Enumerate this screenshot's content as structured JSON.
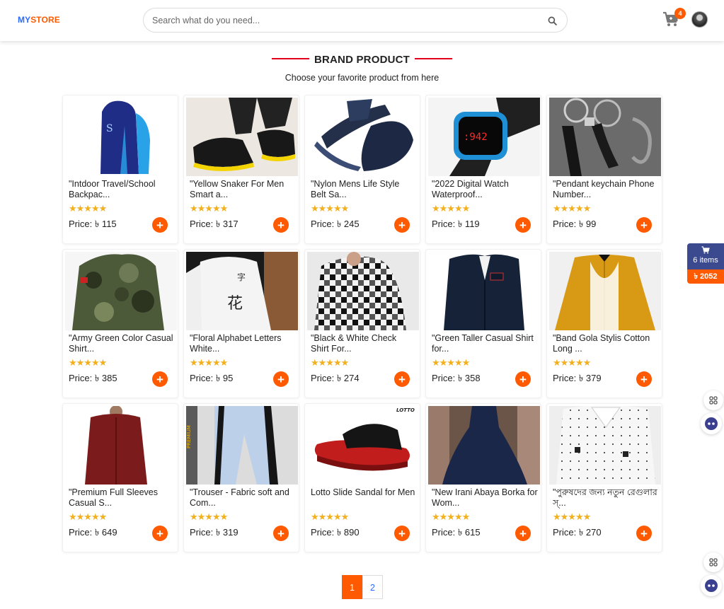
{
  "header": {
    "logo_my": "MY",
    "logo_store": "STORE",
    "search_placeholder": "Search what do you need...",
    "cart_count": "4"
  },
  "section": {
    "title": "BRAND PRODUCT",
    "subtitle": "Choose your favorite product from here"
  },
  "stars": "★★★★★",
  "products": [
    {
      "title": "\"Intdoor Travel/School Backpac...",
      "price": "Price: ৳ 115",
      "icon": "backpack-image"
    },
    {
      "title": "\"Yellow Snaker For Men Smart a...",
      "price": "Price: ৳ 317",
      "icon": "sneaker-image"
    },
    {
      "title": "\"Nylon Mens Life Style Belt Sa...",
      "price": "Price: ৳ 245",
      "icon": "sandal-image"
    },
    {
      "title": "\"2022 Digital Watch Waterproof...",
      "price": "Price: ৳ 119",
      "icon": "watch-image"
    },
    {
      "title": "\"Pendant keychain Phone Number...",
      "price": "Price: ৳ 99",
      "icon": "keychain-image"
    },
    {
      "title": "\"Army Green Color Casual Shirt...",
      "price": "Price: ৳ 385",
      "icon": "camo-shirt-image"
    },
    {
      "title": "\"Floral Alphabet Letters White...",
      "price": "Price: ৳ 95",
      "icon": "white-tshirt-image"
    },
    {
      "title": "\"Black & White Check Shirt For...",
      "price": "Price: ৳ 274",
      "icon": "check-shirt-image"
    },
    {
      "title": "\"Green Taller Casual Shirt for...",
      "price": "Price: ৳ 358",
      "icon": "jacket-image"
    },
    {
      "title": "\"Band Gola Stylis Cotton Long ...",
      "price": "Price: ৳ 379",
      "icon": "yellow-shirt-image"
    },
    {
      "title": "\"Premium Full Sleeves Casual S...",
      "price": "Price: ৳ 649",
      "icon": "maroon-shirt-image"
    },
    {
      "title": "\"Trouser - Fabric soft and Com...",
      "price": "Price: ৳ 319",
      "icon": "trouser-image"
    },
    {
      "title": "Lotto Slide Sandal for Men",
      "price": "Price: ৳ 890",
      "icon": "slide-sandal-image"
    },
    {
      "title": "\"New Irani Abaya Borka for Wom...",
      "price": "Price: ৳ 615",
      "icon": "abaya-image"
    },
    {
      "title": "\"পুরুষদের জন্য নতুন রেগুলার স্...",
      "price": "Price: ৳ 270",
      "icon": "white-shirt-image"
    }
  ],
  "floating_cart": {
    "items": "6 items",
    "total": "৳ 2052"
  },
  "pagination": {
    "pages": [
      "1",
      "2"
    ],
    "active": "1"
  },
  "colors": {
    "accent": "#ff5a00",
    "brand_blue": "#2d6bff",
    "star": "#f2b01e",
    "title_line": "#e3001b",
    "float_cart": "#3b4a8f"
  }
}
